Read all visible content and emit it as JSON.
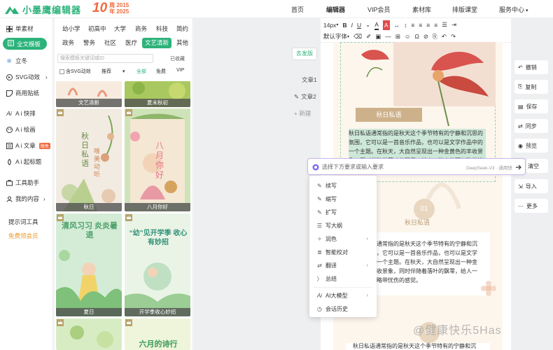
{
  "brand": {
    "name": "小墨鹰编辑器",
    "anniv_big": "10",
    "anniv_top": "周 2015",
    "anniv_bottom": "年 2025"
  },
  "nav": [
    {
      "label": "首页",
      "active": false
    },
    {
      "label": "编辑器",
      "active": true
    },
    {
      "label": "VIP会员",
      "active": false
    },
    {
      "label": "素材库",
      "active": false
    },
    {
      "label": "排版课堂",
      "active": false
    },
    {
      "label": "服务中心",
      "active": false
    }
  ],
  "sidebar": {
    "items": [
      {
        "label": "单素材",
        "icon": "grid-icon"
      },
      {
        "label": "全文模板",
        "icon": "template-icon"
      },
      {
        "label": "立冬",
        "icon": "snowflake-icon"
      },
      {
        "label": "SVG动效",
        "icon": "svg-icon"
      },
      {
        "label": "商用贴纸",
        "icon": "sticker-icon"
      },
      {
        "label": "A i 快排",
        "icon": "ai-layout-icon"
      },
      {
        "label": "A i 绘画",
        "icon": "ai-paint-icon"
      },
      {
        "label": "A i 文章",
        "icon": "ai-article-icon",
        "tag": "限免"
      },
      {
        "label": "A i 起标题",
        "icon": "ai-title-icon"
      },
      {
        "label": "工具助手",
        "icon": "tools-icon"
      },
      {
        "label": "我的内容",
        "icon": "user-icon"
      }
    ],
    "section_label": "提示词工具",
    "promo_label": "免费领会员"
  },
  "templates": {
    "categories_row1": [
      "幼小学",
      "初高中",
      "大学",
      "商务",
      "科技",
      "简约"
    ],
    "categories_row2": [
      "政务",
      "警务",
      "社区",
      "医疗",
      "文艺清新",
      "其他"
    ],
    "active_category": "文艺清新",
    "search_placeholder": "搜索模板关键词或ID",
    "collected": "已收藏",
    "svg_filter": "含SVG动效",
    "sort": "推荐",
    "price_filters": [
      "全部",
      "免费",
      "VIP"
    ],
    "cards": [
      {
        "caption": "文艺清新",
        "poster": ""
      },
      {
        "caption": "夏末秋初",
        "poster": ""
      },
      {
        "caption": "秋日",
        "poster": "秋日私语"
      },
      {
        "caption": "八月你好",
        "poster": "八月你好"
      },
      {
        "caption": "夏日",
        "poster": "清风习习 炎炎暑退"
      },
      {
        "caption": "开学季收心妙招",
        "poster": "“幼”见开学季 收心有妙招"
      },
      {
        "caption": "",
        "poster": ""
      },
      {
        "caption": "",
        "poster": "六月的诗行"
      }
    ],
    "card2_side_text": "唯美动听"
  },
  "canvas": {
    "go_publish": "去发版",
    "docs": [
      "文章1",
      "文章2"
    ],
    "new_doc": "+ 新建"
  },
  "toolbar": {
    "font_size": "14px",
    "font": "默认字体"
  },
  "document": {
    "title": "秋日私语",
    "para1": "秋日私语通常指的是秋天这个季节特有的宁静和沉思的氛围，它可以是一首音乐作品，也可以是文学作品中的一个主题。在秋天，大自然呈现出一种金黄色的丰收景象，同时伴随着落叶的飘零，给人一种宁静而又略带忧伤的感觉。",
    "num1": "01",
    "subtitle1": "秋日私语",
    "para2_line1": "秋日私语通常指的是秋天这个季节特有的宁静和沉",
    "para2_line2": "，它可以是一首音乐作品，也可以是文学",
    "para2_line3": "一个主题。在秋天，大自然呈现出一种金",
    "para2_line4": "收景象，同时伴随着落叶的飘零，给人一",
    "para2_line5": "略带忧伤的感觉。",
    "num2": "02",
    "para3": "秋日私语通常指的是秋天这个季节特有的宁静和沉"
  },
  "ai": {
    "placeholder": "选择下方要求或输入要求",
    "model": "DeepSeek-V3 · 通用快",
    "menu": [
      {
        "label": "续写",
        "icon": "pen-icon",
        "sub": false
      },
      {
        "label": "缩写",
        "icon": "pen-icon",
        "sub": false
      },
      {
        "label": "扩写",
        "icon": "pen-icon",
        "sub": false
      },
      {
        "label": "写大纲",
        "icon": "outline-icon",
        "sub": false
      },
      {
        "label": "润色",
        "icon": "polish-icon",
        "sub": true
      },
      {
        "label": "智能校对",
        "icon": "check-icon",
        "sub": false
      },
      {
        "label": "翻译",
        "icon": "translate-icon",
        "sub": true
      },
      {
        "label": "总结",
        "icon": "summary-icon",
        "sub": false
      },
      {
        "label": "AI大模型",
        "icon": "ai-model-icon",
        "sub": true
      },
      {
        "label": "会话历史",
        "icon": "history-icon",
        "sub": false
      }
    ]
  },
  "rail": [
    "撤销",
    "复制",
    "保存",
    "同步",
    "预览",
    "清空",
    "导入",
    "更多"
  ],
  "watermark": "@健康快乐5Has",
  "colors": {
    "brand_green": "#2cb27a",
    "accent_orange": "#f06a3c"
  }
}
